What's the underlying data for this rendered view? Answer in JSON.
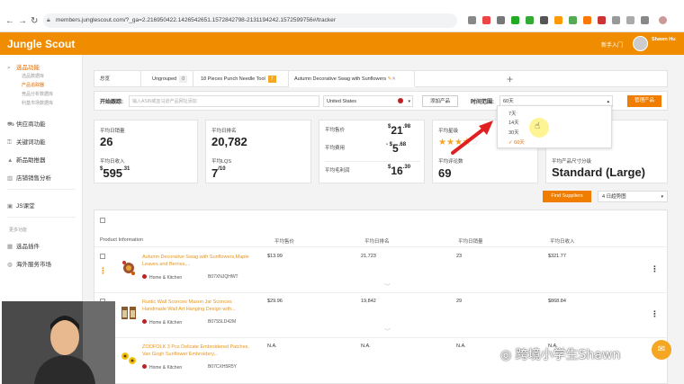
{
  "browser": {
    "url": "members.junglescout.com/?_ga=2.216950422.1426542651.1572842798-2131194242.1572599756#/tracker"
  },
  "header": {
    "logo": "Jungle Scout",
    "newbie": "新手入门",
    "username": "Shawn Hu"
  },
  "sidebar": {
    "items": [
      {
        "label": "选品功能",
        "active": true
      },
      {
        "label": "供应商功能"
      },
      {
        "label": "关键词功能"
      },
      {
        "label": "新品助推器"
      },
      {
        "label": "店铺销售分析"
      },
      {
        "label": "JS课堂"
      },
      {
        "label": "选品插件"
      },
      {
        "label": "海外服务市场"
      }
    ],
    "subitems": [
      "选品数据库",
      "产品追踪器",
      "竞品分析数据库",
      "利基市场数据库"
    ],
    "more_label": "更多功能"
  },
  "tabs": [
    {
      "label": "总览",
      "badge": ""
    },
    {
      "label": "Ungrouped",
      "badge": "0"
    },
    {
      "label": "18 Pieces Punch Needle Tool",
      "badge": "7"
    },
    {
      "label": "Autumn Decorative Swag with Sunflowers",
      "badge": ""
    }
  ],
  "filter": {
    "start_label": "开始跟踪:",
    "asin_placeholder": "输入ASIN或亚马逊产品网址添加",
    "marketplace": "United States",
    "add_button": "添加产品",
    "range_label": "时间范围:",
    "range_value": "60天",
    "manage_button": "管理产品"
  },
  "dropdown": {
    "options": [
      "7天",
      "14天",
      "30天",
      "60天"
    ],
    "selected": "60天"
  },
  "stats": {
    "daily_sales_label": "平均日销量",
    "daily_sales": "26",
    "daily_revenue_label": "平均日收入",
    "daily_revenue_int": "595",
    "daily_revenue_dec": ".31",
    "avg_rank_label": "平均日排名",
    "avg_rank": "20,782",
    "lqs_label": "平均LQS",
    "lqs": "7",
    "lqs_max": "/10",
    "price_label": "平均售价",
    "price_int": "21",
    "price_dec": ".98",
    "fees_label": "平均费用",
    "fees_int": "5",
    "fees_dec": ".68",
    "profit_label": "平均毛利润",
    "profit_int": "16",
    "profit_dec": ".30",
    "rating_label": "平均星级",
    "rating": 3.5,
    "reviews_label": "平均评论数",
    "reviews": "69",
    "size_label": "平均产品尺寸分级",
    "size": "Standard (Large)"
  },
  "actions": {
    "find_suppliers": "Find Suppliers",
    "period": "4 日趋势图"
  },
  "table": {
    "columns": [
      "Product Information",
      "平均售价",
      "平均日排名",
      "平均日销量",
      "平均日收入"
    ],
    "rows": [
      {
        "title": "Autumn Decorative Swag with Sunflowers,Maple Leaves and Berries,...",
        "category": "Home & Kitchen",
        "asin": "B07XNJQHWT",
        "price": "$13.99",
        "rank": "21,723",
        "sales": "23",
        "revenue": "$321.77"
      },
      {
        "title": "Rustic Wall Sconces Mason Jar Sconces Handmade Wall Art Hanging Design with...",
        "category": "Home & Kitchen",
        "asin": "B07S5LD42M",
        "price": "$29.96",
        "rank": "19,842",
        "sales": "29",
        "revenue": "$868.84"
      },
      {
        "title": "ZOOFOLK 3 Pcs Delicate Embroidered Patches, Van Gogh Sunflower Embroidery...",
        "category": "Home & Kitchen",
        "asin": "B07CXH5R5Y",
        "price": "N.A.",
        "rank": "N.A.",
        "sales": "N.A.",
        "revenue": "N.A."
      }
    ]
  },
  "watermark": "跨境小学生Shawn",
  "colors": {
    "brand": "#f08c00",
    "accent": "#e36b00",
    "link": "#e8951a"
  }
}
